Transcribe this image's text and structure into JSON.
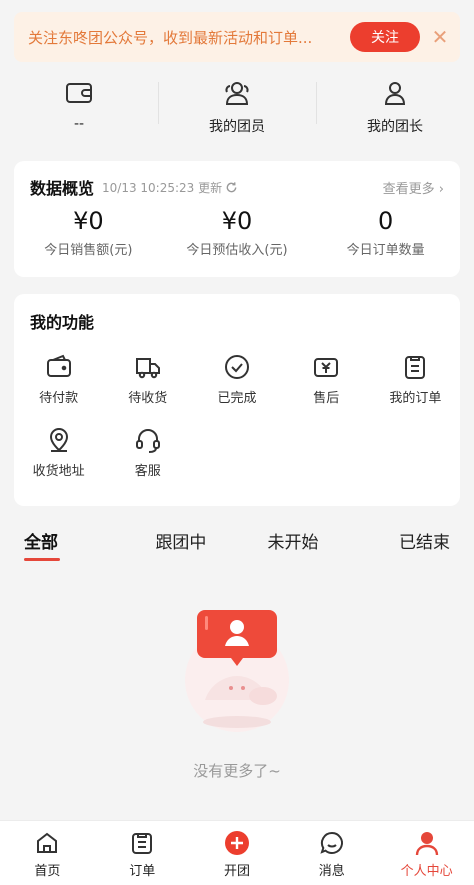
{
  "notice": {
    "text": "关注东咚团公众号，收到最新活动和订单...",
    "follow_label": "关注",
    "close_symbol": "✕"
  },
  "top_stats": [
    {
      "icon": "wallet-icon",
      "label": "--"
    },
    {
      "icon": "team-members-icon",
      "label": "我的团员"
    },
    {
      "icon": "leader-icon",
      "label": "我的团长"
    }
  ],
  "data_overview": {
    "title": "数据概览",
    "timestamp": "10/13 10:25:23 更新",
    "more_label": "查看更多 ›",
    "metrics": [
      {
        "value": "¥0",
        "label": "今日销售额(元)"
      },
      {
        "value": "¥0",
        "label": "今日预估收入(元)"
      },
      {
        "value": "0",
        "label": "今日订单数量"
      }
    ]
  },
  "functions": {
    "title": "我的功能",
    "items": [
      {
        "icon": "wallet-icon",
        "label": "待付款"
      },
      {
        "icon": "truck-icon",
        "label": "待收货"
      },
      {
        "icon": "check-circle-icon",
        "label": "已完成"
      },
      {
        "icon": "after-sales-icon",
        "label": "售后"
      },
      {
        "icon": "order-list-icon",
        "label": "我的订单"
      },
      {
        "icon": "location-pin-icon",
        "label": "收货地址"
      },
      {
        "icon": "headset-icon",
        "label": "客服"
      }
    ]
  },
  "tabs": [
    {
      "label": "全部",
      "active": true
    },
    {
      "label": "跟团中",
      "active": false
    },
    {
      "label": "未开始",
      "active": false
    },
    {
      "label": "已结束",
      "active": false
    }
  ],
  "empty_state": {
    "text": "没有更多了~"
  },
  "bottom_nav": [
    {
      "icon": "home-icon",
      "label": "首页",
      "active": false
    },
    {
      "icon": "order-icon",
      "label": "订单",
      "active": false
    },
    {
      "icon": "plus-circle-icon",
      "label": "开团",
      "active": false
    },
    {
      "icon": "message-icon",
      "label": "消息",
      "active": false
    },
    {
      "icon": "profile-icon",
      "label": "个人中心",
      "active": true
    }
  ],
  "colors": {
    "accent": "#e5473a",
    "notice_bg": "#fdf1e6",
    "notice_text": "#e3793a",
    "page_bg": "#f4f4f4"
  }
}
